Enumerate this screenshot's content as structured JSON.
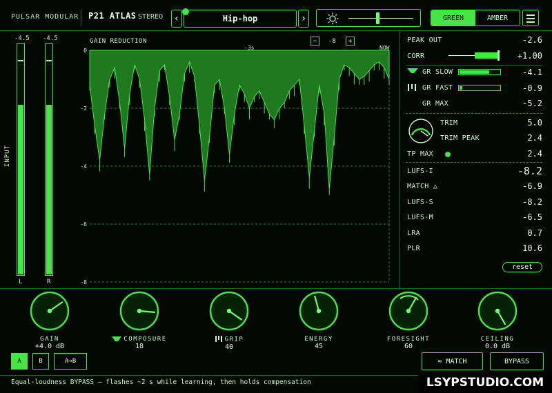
{
  "header": {
    "brand": "PULSAR MODULAR",
    "model": "P21 ATLAS",
    "channel": "STEREO",
    "prev_glyph": "‹",
    "next_glyph": "›",
    "preset": "Hip-hop",
    "brightness_icon": "sun-icon",
    "theme_options": [
      "GREEN",
      "AMBER"
    ],
    "theme_selected": "GREEN"
  },
  "input": {
    "label": "INPUT",
    "left": {
      "value_text": "-4.5",
      "level": 0.74,
      "peak": 0.93,
      "label": "L"
    },
    "right": {
      "value_text": "-4.5",
      "level": 0.74,
      "peak": 0.93,
      "label": "R"
    }
  },
  "graph": {
    "title": "GAIN REDUCTION",
    "zoom_minus": "−",
    "zoom_value": "-8",
    "zoom_plus": "+",
    "time_marker": "-3s",
    "now_label": "NOW",
    "y_ticks": [
      "0",
      "-2",
      "-4",
      "-6",
      "-8"
    ]
  },
  "chart_data": {
    "type": "area",
    "title": "GAIN REDUCTION",
    "ylim": [
      0,
      -8
    ],
    "y_ticks": [
      0,
      -2,
      -4,
      -6,
      -8
    ],
    "series": [
      {
        "values": [
          -1.2,
          -2.6,
          -3.8,
          -2.2,
          -1.0,
          -0.6,
          -1.8,
          -3.4,
          -1.5,
          -0.5,
          -1.0,
          -2.4,
          -4.3,
          -2.0,
          -0.7,
          -0.5,
          -1.6,
          -3.1,
          -2.2,
          -0.8,
          -0.4,
          -0.9,
          -2.6,
          -4.5,
          -3.0,
          -1.2,
          -1.0,
          -2.0,
          -3.6,
          -2.2,
          -1.2,
          -1.5,
          -2.0,
          -1.6,
          -1.4,
          -1.8,
          -2.2,
          -2.4,
          -2.0,
          -1.8,
          -1.4,
          -1.2,
          -1.0,
          -2.6,
          -4.4,
          -2.8,
          -1.2,
          -2.2,
          -4.8,
          -3.0,
          -1.0,
          -0.5,
          -0.6,
          -0.8,
          -1.0,
          -0.9,
          -0.7,
          -0.5,
          -0.4,
          -0.6,
          -1.0
        ]
      }
    ]
  },
  "stats": {
    "peak_out": {
      "label": "PEAK OUT",
      "value": "-2.6"
    },
    "corr": {
      "label": "CORR",
      "value": "+1.00",
      "level": 1.0
    },
    "gr_slow": {
      "label": "GR SLOW",
      "value": "-4.1",
      "level": 0.72,
      "icon": "slow-funnel-icon"
    },
    "gr_fast": {
      "label": "GR FAST",
      "value": "-0.9",
      "level": 0.06,
      "icon": "fast-bars-icon"
    },
    "gr_max": {
      "label": "GR MAX",
      "value": "-5.2"
    },
    "trim": {
      "label": "TRIM",
      "value": "5.0"
    },
    "trim_peak": {
      "label": "TRIM PEAK",
      "value": "2.4"
    },
    "tp_max": {
      "label": "TP MAX",
      "value": "2.4"
    },
    "lufs_i": {
      "label": "LUFS-I",
      "value": "-8.2"
    },
    "match": {
      "label": "MATCH △",
      "value": "-6.9"
    },
    "lufs_s": {
      "label": "LUFS-S",
      "value": "-8.2"
    },
    "lufs_m": {
      "label": "LUFS-M",
      "value": "-6.5"
    },
    "lra": {
      "label": "LRA",
      "value": "0.7"
    },
    "plr": {
      "label": "PLR",
      "value": "10.6"
    },
    "reset": "reset"
  },
  "knobs": [
    {
      "label": "GAIN",
      "value": "+4.0 dB",
      "angle": 55
    },
    {
      "label": "COMPOSURE",
      "value": "18",
      "angle": 95,
      "icon": "funnel-icon"
    },
    {
      "label": "GRIP",
      "value": "40",
      "angle": 125,
      "icon": "bars-icon"
    },
    {
      "label": "ENERGY",
      "value": "45",
      "angle": -15
    },
    {
      "label": "FORESIGHT",
      "value": "60",
      "angle": 30
    },
    {
      "label": "CEILING",
      "value": "0.0 dB",
      "angle": 150
    }
  ],
  "footer": {
    "a": "A",
    "b": "B",
    "ab": "A→B",
    "match": "≈ MATCH",
    "bypass": "BYPASS",
    "status": "Equal-loudness BYPASS — flashes ~2 s while learning, then holds compensation",
    "watermark": "LSYPSTUDIO.COM"
  },
  "colors": {
    "accent": "#45e545",
    "background": "#030803"
  }
}
